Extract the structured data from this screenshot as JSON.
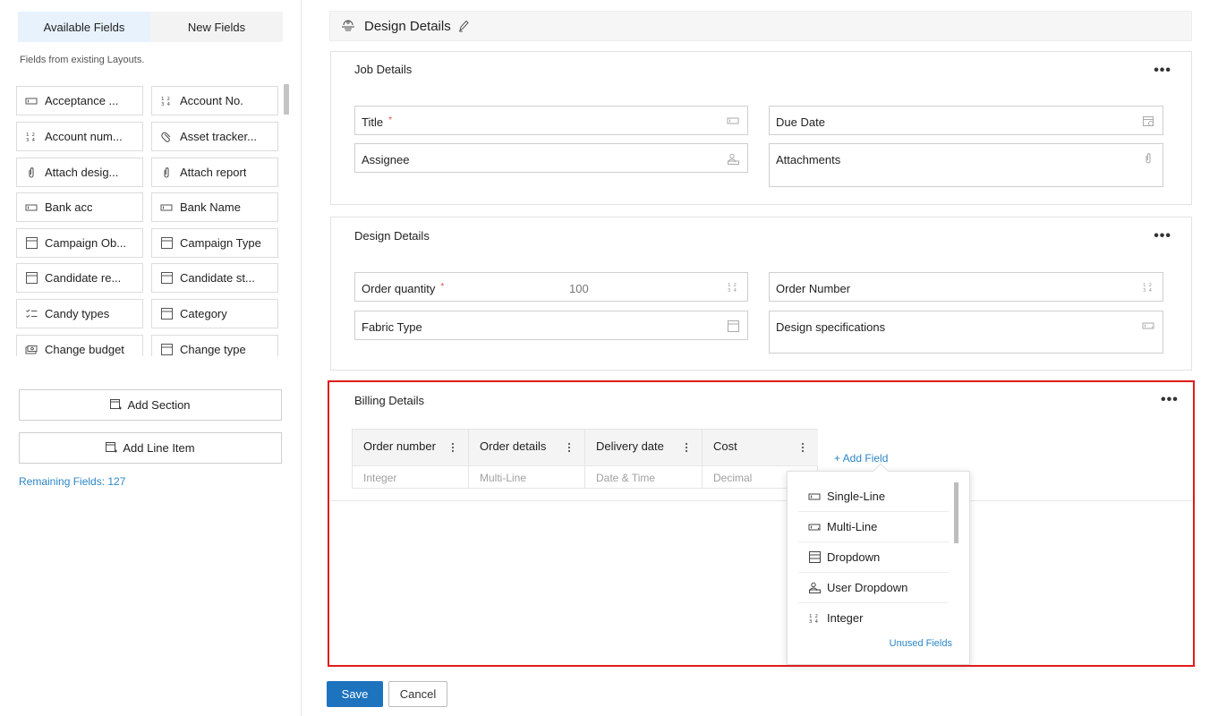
{
  "left_panel": {
    "tabs": [
      {
        "label": "Available Fields"
      },
      {
        "label": "New Fields"
      }
    ],
    "hint": "Fields from existing Layouts.",
    "fields": [
      {
        "label": "Acceptance ...",
        "icon": "single-line-icon"
      },
      {
        "label": "Account No.",
        "icon": "integer-icon"
      },
      {
        "label": "Account num...",
        "icon": "integer-icon"
      },
      {
        "label": "Asset tracker...",
        "icon": "attachment-icon"
      },
      {
        "label": "Attach desig...",
        "icon": "attachment-icon"
      },
      {
        "label": "Attach report",
        "icon": "attachment-icon"
      },
      {
        "label": "Bank acc",
        "icon": "single-line-icon"
      },
      {
        "label": "Bank Name",
        "icon": "single-line-icon"
      },
      {
        "label": "Campaign Ob...",
        "icon": "dropdown-icon"
      },
      {
        "label": "Campaign Type",
        "icon": "dropdown-icon"
      },
      {
        "label": "Candidate re...",
        "icon": "dropdown-icon"
      },
      {
        "label": "Candidate st...",
        "icon": "dropdown-icon"
      },
      {
        "label": "Candy types",
        "icon": "checklist-icon"
      },
      {
        "label": "Category",
        "icon": "dropdown-icon"
      },
      {
        "label": "Change budget",
        "icon": "currency-icon"
      },
      {
        "label": "Change type",
        "icon": "dropdown-icon"
      }
    ],
    "add_section_label": "Add Section",
    "add_line_item_label": "Add Line Item",
    "remaining_fields": "Remaining Fields: 127"
  },
  "header": {
    "title": "Design Details"
  },
  "sections": {
    "job": {
      "title": "Job Details",
      "fields": [
        {
          "label": "Title",
          "required": "*"
        },
        {
          "label": "Due Date"
        },
        {
          "label": "Assignee"
        },
        {
          "label": "Attachments"
        }
      ]
    },
    "design": {
      "title": "Design Details",
      "fields": [
        {
          "label": "Order quantity",
          "required": "*",
          "value": "100"
        },
        {
          "label": "Order Number"
        },
        {
          "label": "Fabric Type"
        },
        {
          "label": "Design specifications"
        }
      ]
    },
    "billing": {
      "title": "Billing Details",
      "columns": [
        {
          "header": "Order number",
          "type": "Integer"
        },
        {
          "header": "Order details",
          "type": "Multi-Line"
        },
        {
          "header": "Delivery date",
          "type": "Date & Time"
        },
        {
          "header": "Cost",
          "type": "Decimal"
        }
      ],
      "add_field_label": "+ Add Field"
    }
  },
  "field_type_menu": {
    "options": [
      {
        "label": "Single-Line",
        "icon": "single-line-icon"
      },
      {
        "label": "Multi-Line",
        "icon": "multi-line-icon"
      },
      {
        "label": "Dropdown",
        "icon": "dropdown-icon"
      },
      {
        "label": "User Dropdown",
        "icon": "user-dropdown-icon"
      },
      {
        "label": "Integer",
        "icon": "integer-icon"
      }
    ],
    "unused_fields_label": "Unused Fields"
  },
  "footer": {
    "save_label": "Save",
    "cancel_label": "Cancel"
  },
  "colors": {
    "accent": "#1e73be",
    "link": "#2b86c7",
    "highlight": "#e01b1b",
    "required": "#e44d4d"
  }
}
